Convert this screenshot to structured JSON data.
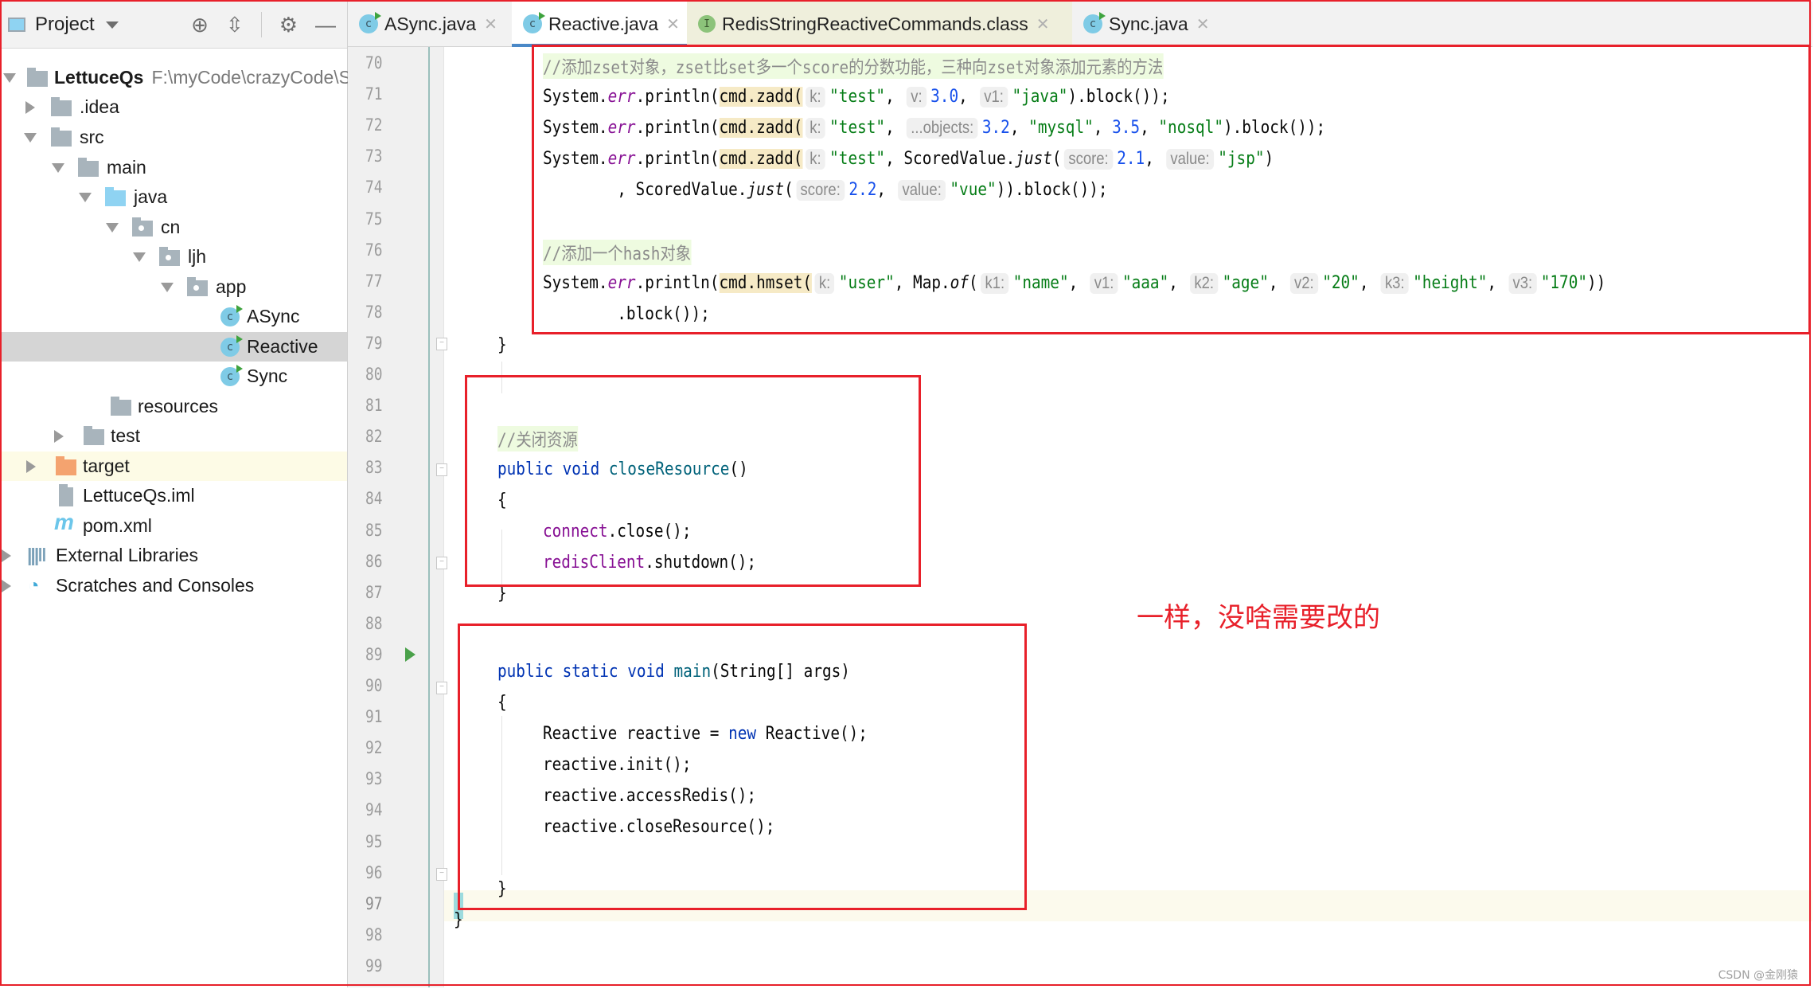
{
  "sidebar": {
    "title": "Project",
    "header_icons": [
      "locate-icon",
      "collapse-all-icon",
      "settings-gear-icon",
      "hide-minus-icon"
    ],
    "tree": [
      {
        "label": "LettuceQs",
        "path": "F:\\myCode\\crazyCode\\S",
        "icon": "module-folder",
        "expanded": true
      },
      {
        "label": ".idea",
        "icon": "folder",
        "expanded": false
      },
      {
        "label": "src",
        "icon": "folder",
        "expanded": true
      },
      {
        "label": "main",
        "icon": "folder",
        "expanded": true
      },
      {
        "label": "java",
        "icon": "source-folder",
        "expanded": true
      },
      {
        "label": "cn",
        "icon": "package",
        "expanded": true
      },
      {
        "label": "ljh",
        "icon": "package",
        "expanded": true
      },
      {
        "label": "app",
        "icon": "package",
        "expanded": true
      },
      {
        "label": "ASync",
        "icon": "class-runnable"
      },
      {
        "label": "Reactive",
        "icon": "class-runnable",
        "selected": true
      },
      {
        "label": "Sync",
        "icon": "class-runnable"
      },
      {
        "label": "resources",
        "icon": "resources-folder"
      },
      {
        "label": "test",
        "icon": "folder",
        "expanded": false
      },
      {
        "label": "target",
        "icon": "excluded-folder",
        "expanded": false
      },
      {
        "label": "LettuceQs.iml",
        "icon": "iml-file"
      },
      {
        "label": "pom.xml",
        "icon": "maven-file"
      },
      {
        "label": "External Libraries",
        "icon": "libraries",
        "expanded": false
      },
      {
        "label": "Scratches and Consoles",
        "icon": "scratches",
        "expanded": false
      }
    ]
  },
  "tabs": [
    {
      "label": "ASync.java",
      "icon": "class",
      "active": false
    },
    {
      "label": "Reactive.java",
      "icon": "class",
      "active": true
    },
    {
      "label": "RedisStringReactiveCommands.class",
      "icon": "interface",
      "active": false
    },
    {
      "label": "Sync.java",
      "icon": "class",
      "active": false
    }
  ],
  "tab_close_glyph": "✕",
  "editor": {
    "line_numbers": [
      "70",
      "71",
      "72",
      "73",
      "74",
      "75",
      "76",
      "77",
      "78",
      "79",
      "80",
      "81",
      "82",
      "83",
      "84",
      "85",
      "86",
      "87",
      "88",
      "89",
      "90",
      "91",
      "92",
      "93",
      "94",
      "95",
      "96",
      "97",
      "98",
      "99"
    ],
    "current_line": "97",
    "code": {
      "l70": {
        "slashes": "//",
        "text1": "添加",
        "m1": "zset",
        "text2": "对象，",
        "m2": "zset",
        "text3": "比",
        "m3": "set",
        "text4": "多一个",
        "m4": "score",
        "text5": "的分数功能，三种向",
        "m5": "zset",
        "text6": "对象添加元素的方法"
      },
      "l71": {
        "a": "System.",
        "err": "err",
        "b": ".println(",
        "call": "cmd.zadd(",
        "h1": "k:",
        "s1": "\"test\"",
        "c1": ", ",
        "h2": "v:",
        "n1": "3.0",
        "c2": ", ",
        "h3": "v1:",
        "s2": "\"java\"",
        "end": ").block());"
      },
      "l72": {
        "a": "System.",
        "err": "err",
        "b": ".println(",
        "call": "cmd.zadd(",
        "h1": "k:",
        "s1": "\"test\"",
        "c1": ", ",
        "h2": "...objects:",
        "n1": "3.2",
        "c2": ", ",
        "s2": "\"mysql\"",
        "c3": ", ",
        "n2": "3.5",
        "c4": ", ",
        "s3": "\"nosql\"",
        "end": ").block());"
      },
      "l73": {
        "a": "System.",
        "err": "err",
        "b": ".println(",
        "call": "cmd.zadd(",
        "h1": "k:",
        "s1": "\"test\"",
        "c1": ", ScoredValue.",
        "just": "just",
        "p": "(",
        "h2": "score:",
        "n1": "2.1",
        "c2": ", ",
        "h3": "value:",
        "s2": "\"jsp\"",
        "end": ")"
      },
      "l74": {
        "a": "        , ScoredValue.",
        "just": "just",
        "p": "(",
        "h1": "score:",
        "n1": "2.2",
        "c1": ", ",
        "h2": "value:",
        "s1": "\"vue\"",
        "end": ")).block());"
      },
      "l76": {
        "slashes": "//",
        "text1": "添加一个",
        "m1": "hash",
        "text2": "对象"
      },
      "l77": {
        "a": "System.",
        "err": "err",
        "b": ".println(",
        "call": "cmd.hmset(",
        "h1": "k:",
        "s1": "\"user\"",
        "c1": ", Map.",
        "of": "of",
        "p": "(",
        "h2": "k1:",
        "s2": "\"name\"",
        "c2": ", ",
        "h3": "v1:",
        "s3": "\"aaa\"",
        "c3": ", ",
        "h4": "k2:",
        "s4": "\"age\"",
        "c4": ", ",
        "h5": "v2:",
        "s5": "\"20\"",
        "c5": ", ",
        "h6": "k3:",
        "s6": "\"height\"",
        "c6": ", ",
        "h7": "v3:",
        "s7": "\"170\"",
        "end": "))"
      },
      "l78": {
        "a": "        .block());"
      },
      "l79": {
        "a": "}"
      },
      "l81": {
        "slashes": "//",
        "text1": "关闭资源"
      },
      "l82": {
        "kw1": "public",
        "kw2": "void",
        "name": "closeResource",
        "end": "()"
      },
      "l83": {
        "a": "{"
      },
      "l84": {
        "f": "connect",
        "end": ".close();"
      },
      "l85": {
        "f": "redisClient",
        "end": ".shutdown();"
      },
      "l86": {
        "a": "}"
      },
      "l89": {
        "kw1": "public",
        "kw2": "static",
        "kw3": "void",
        "name": "main",
        "end": "(String[] args)"
      },
      "l90": {
        "a": "{"
      },
      "l91": {
        "a": "Reactive reactive = ",
        "kw": "new",
        "end": " Reactive();"
      },
      "l92": {
        "a": "reactive.init();"
      },
      "l93": {
        "a": "reactive.accessRedis();"
      },
      "l94": {
        "a": "reactive.closeResource();"
      },
      "l96": {
        "a": "}"
      },
      "l97": {
        "a": "}"
      }
    }
  },
  "annotation": "一样，没啥需要改的",
  "watermark": "CSDN @金刚猿",
  "colors": {
    "annotation_red": "#e8202a",
    "keyword": "#0033b3",
    "string": "#067d17",
    "number": "#1750eb",
    "field": "#871094",
    "comment_bg": "#eefbe0",
    "active_tab_underline": "#4a88c7"
  }
}
